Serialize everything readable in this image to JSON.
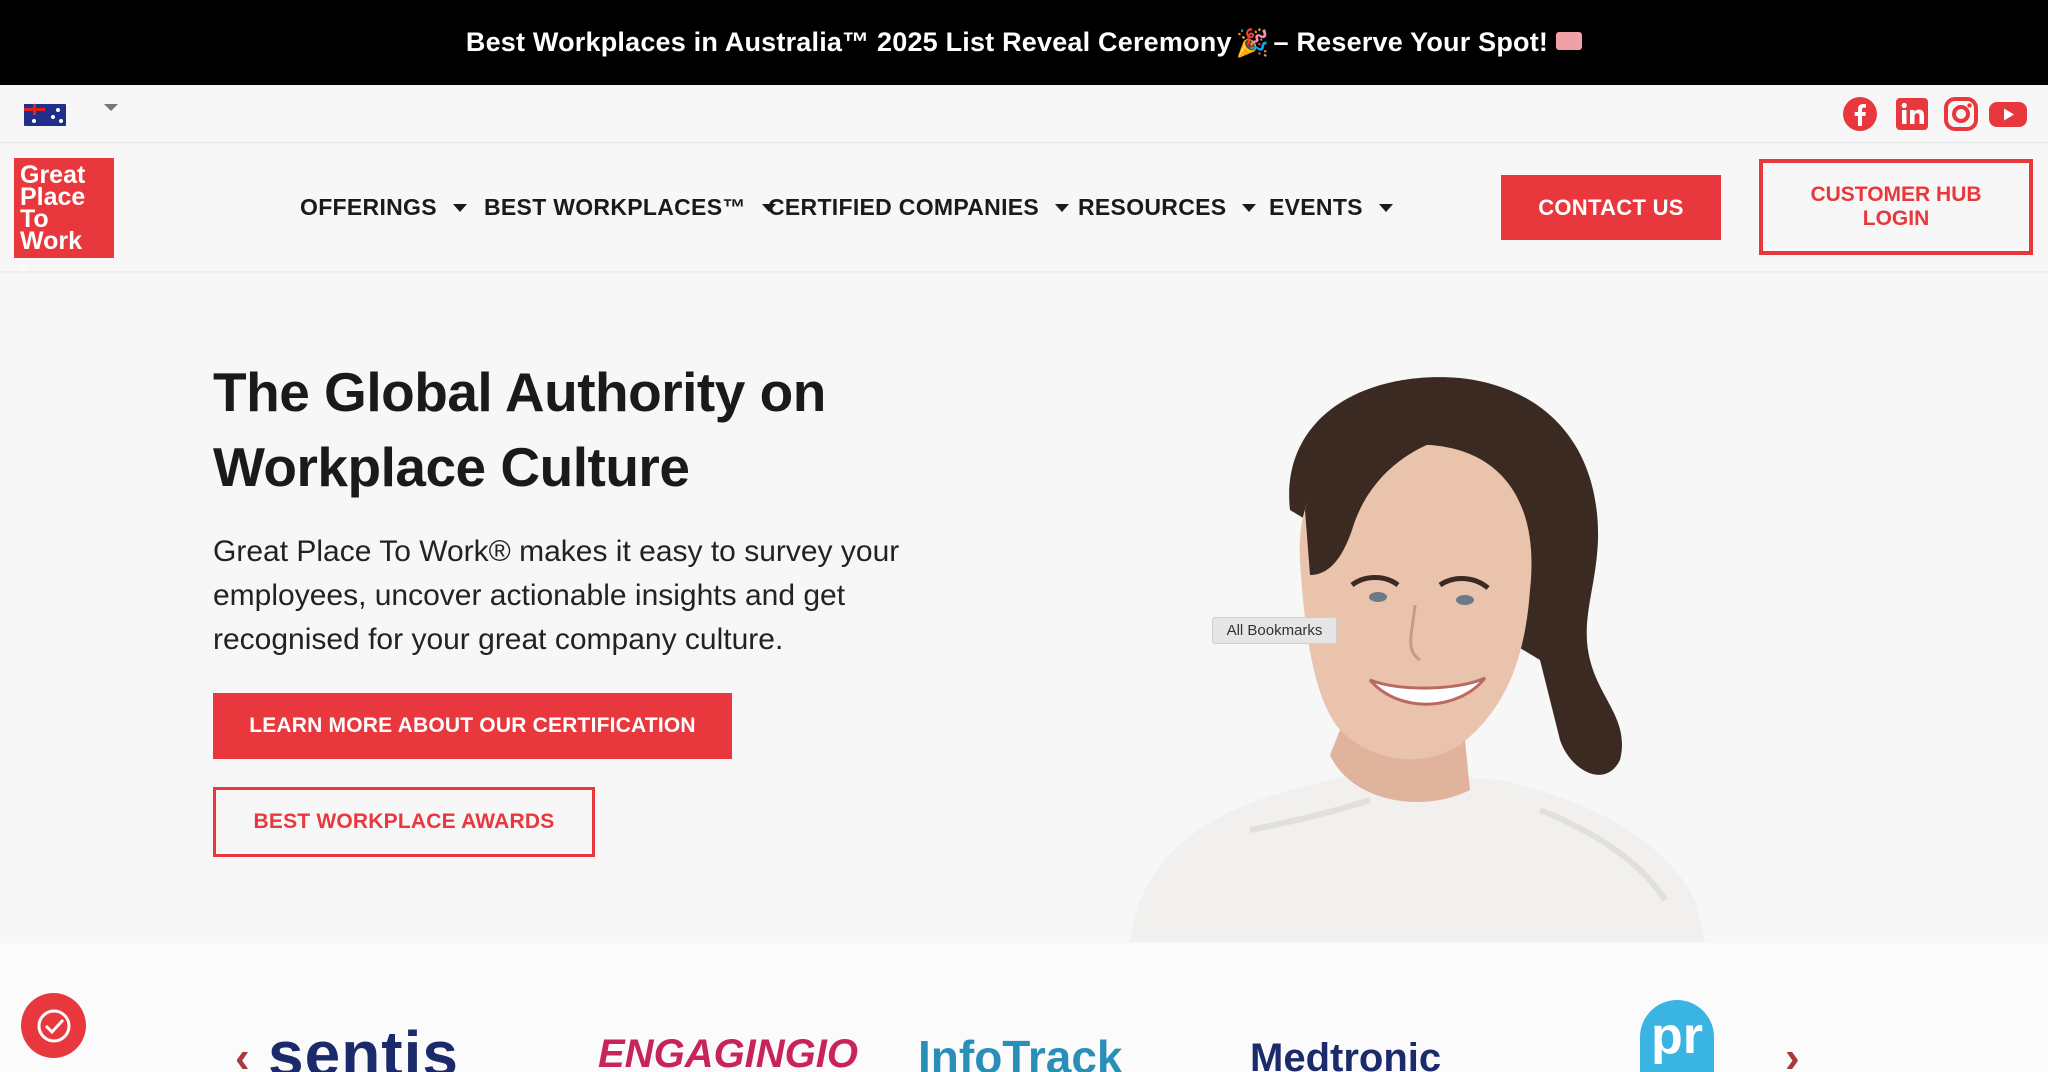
{
  "announcement": {
    "text_before": "Best Workplaces in Australia™ 2025 List Reveal Ceremony",
    "emoji": "🎉",
    "text_after": "– Reserve Your Spot!"
  },
  "utility_bar": {
    "flag": "australia-flag",
    "social": [
      "facebook-icon",
      "linkedin-icon",
      "instagram-icon",
      "youtube-icon"
    ]
  },
  "logo": {
    "line1": "Great",
    "line2": "Place",
    "line3": "To",
    "line4": "Work",
    "mark": "®"
  },
  "nav": {
    "items": [
      "OFFERINGS",
      "BEST WORKPLACES™",
      "CERTIFIED COMPANIES",
      "RESOURCES",
      "EVENTS"
    ],
    "contact_label": "CONTACT US",
    "hub_label": "CUSTOMER HUB LOGIN"
  },
  "hero": {
    "headline": "The Global Authority on Workplace Culture",
    "subtext": "Great Place To Work® makes it easy to survey your employees, uncover actionable insights and get recognised for your great company culture.",
    "primary_cta": "LEARN MORE ABOUT OUR CERTIFICATION",
    "secondary_cta": "BEST WORKPLACE AWARDS"
  },
  "tooltip": "All Bookmarks",
  "partners": [
    "sentis",
    "ENGAGINGIO",
    "InfoTrack",
    "Medtronic",
    "pr"
  ],
  "colors": {
    "brand_red": "#e8383d",
    "announcement_bg": "#000000",
    "text_dark": "#1a1a1a"
  }
}
